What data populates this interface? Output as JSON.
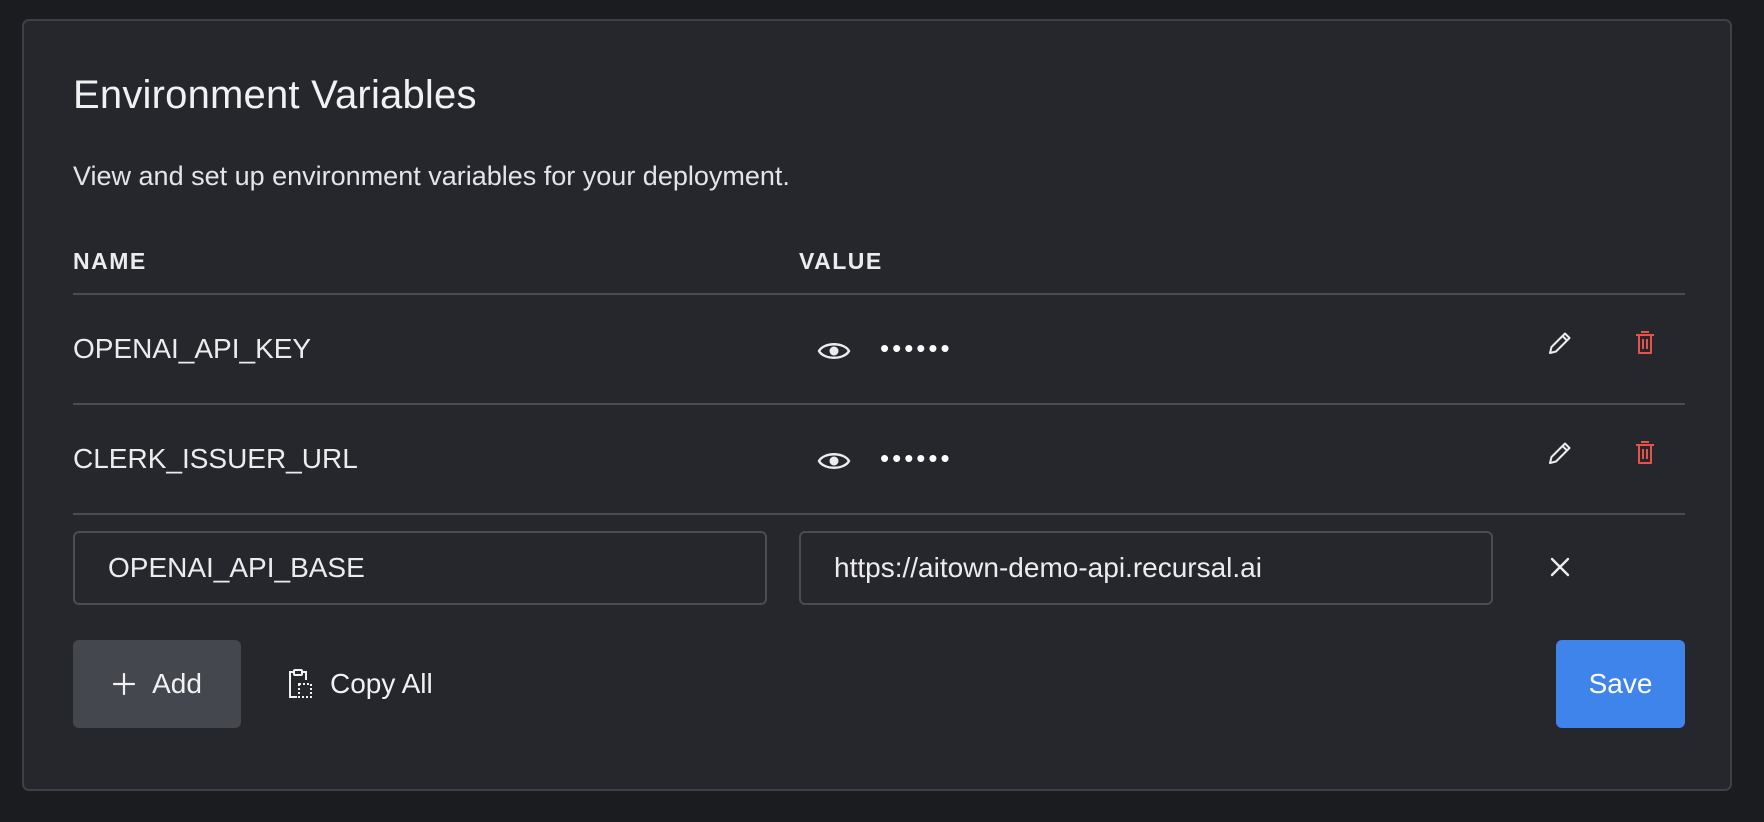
{
  "panel": {
    "title": "Environment Variables",
    "subtitle": "View and set up environment variables for your deployment."
  },
  "table": {
    "headers": {
      "name": "NAME",
      "value": "VALUE"
    },
    "rows": [
      {
        "name": "OPENAI_API_KEY",
        "masked_value": "••••••"
      },
      {
        "name": "CLERK_ISSUER_URL",
        "masked_value": "••••••"
      }
    ]
  },
  "new_entry": {
    "name_value": "OPENAI_API_BASE",
    "value_value": "https://aitown-demo-api.recursal.ai"
  },
  "actions": {
    "add_label": "Add",
    "copy_all_label": "Copy All",
    "save_label": "Save"
  },
  "icons": {
    "reveal": "eye-icon",
    "edit": "pencil-icon",
    "delete": "trash-icon",
    "remove": "close-icon",
    "add": "plus-icon",
    "copy": "clipboard-icon"
  },
  "colors": {
    "background": "#1b1c20",
    "panel": "#26272d",
    "border": "#3f4047",
    "delete": "#e5534b",
    "primary": "#3f84ea",
    "secondary_button": "#45474e"
  }
}
